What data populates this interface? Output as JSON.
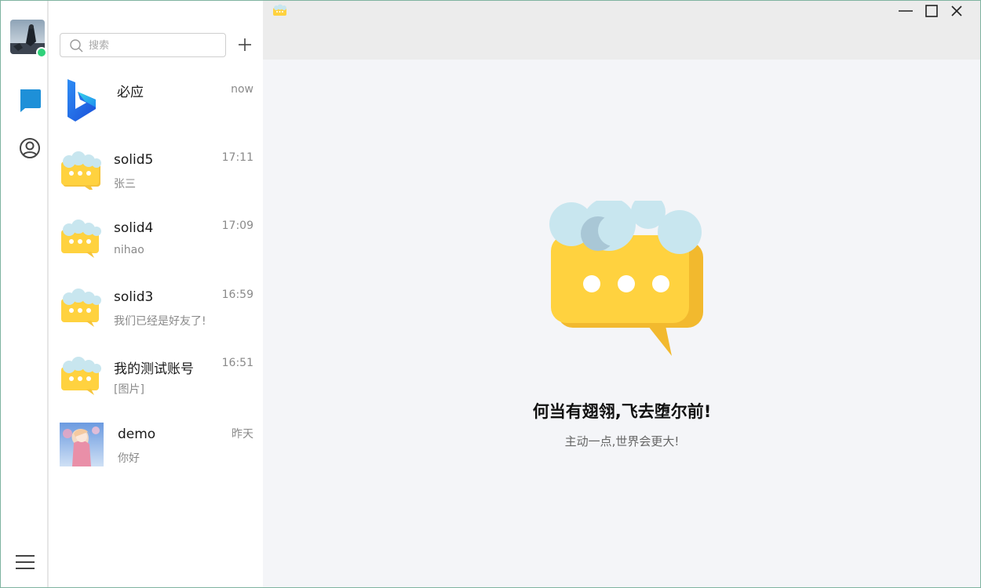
{
  "search": {
    "placeholder": "搜索"
  },
  "rail": {
    "nav": [
      {
        "name": "messages",
        "icon": "chat-bubble-icon",
        "active": true
      },
      {
        "name": "contacts",
        "icon": "user-circle-icon",
        "active": false
      }
    ],
    "menu_icon": "hamburger-menu-icon",
    "status": "online"
  },
  "conversations": [
    {
      "name": "必应",
      "preview": "",
      "time": "now",
      "avatar": "bing-logo"
    },
    {
      "name": "solid5",
      "preview": "张三",
      "time": "17:11",
      "avatar": "cloud-chat-bubble"
    },
    {
      "name": "solid4",
      "preview": "nihao",
      "time": "17:09",
      "avatar": "cloud-chat-bubble"
    },
    {
      "name": "solid3",
      "preview": "我们已经是好友了!",
      "time": "16:59",
      "avatar": "cloud-chat-bubble"
    },
    {
      "name": "我的测试账号",
      "preview": "[图片]",
      "time": "16:51",
      "avatar": "cloud-chat-bubble"
    },
    {
      "name": "demo",
      "preview": "你好",
      "time": "昨天",
      "avatar": "anime-photo"
    }
  ],
  "welcome": {
    "title": "何当有翅翎,飞去堕尔前!",
    "subtitle": "主动一点,世界会更大!"
  },
  "colors": {
    "accent": "#1e90d8",
    "online": "#2fd17a",
    "bubble_yellow": "#ffd23f",
    "cloud": "#c8e6ef",
    "titlebar_bg": "#ececec",
    "main_bg": "#f4f5f8"
  }
}
